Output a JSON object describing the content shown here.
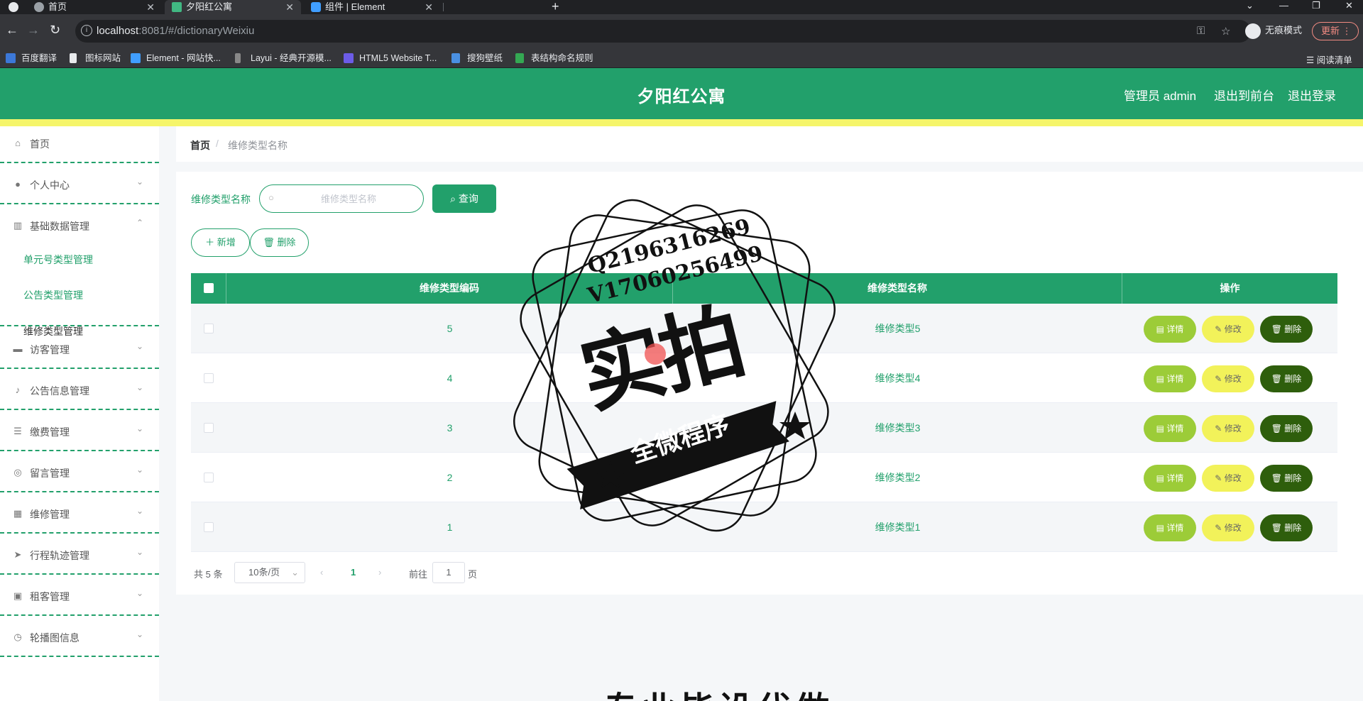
{
  "browser": {
    "tabs": [
      {
        "label": "首页",
        "active": false
      },
      {
        "label": "夕阳红公寓",
        "active": true
      },
      {
        "label": "组件 | Element",
        "active": false
      }
    ],
    "url_host": "localhost",
    "url_rest": ":8081/#/dictionaryWeixiu",
    "incognito_label": "无痕模式",
    "update_label": "更新",
    "bookmarks": [
      "百度翻译",
      "图标网站",
      "Element - 网站快...",
      "Layui - 经典开源模...",
      "HTML5 Website T...",
      "搜狗壁纸",
      "表结构命名规则"
    ],
    "reading_list": "阅读清单"
  },
  "header": {
    "title": "夕阳红公寓",
    "admin_label": "管理员 admin",
    "front_label": "退出到前台",
    "logout_label": "退出登录",
    "colors": {
      "primary": "#22a06b",
      "strip": "#f5f56a"
    }
  },
  "sidebar": {
    "items": [
      {
        "label": "首页",
        "icon": "home-icon"
      },
      {
        "label": "个人中心",
        "icon": "user-icon"
      },
      {
        "label": "基础数据管理",
        "icon": "library-icon"
      },
      {
        "label": "访客管理",
        "icon": "monitor-icon"
      },
      {
        "label": "公告信息管理",
        "icon": "microphone-icon"
      },
      {
        "label": "缴费管理",
        "icon": "sliders-icon"
      },
      {
        "label": "留言管理",
        "icon": "compass-icon"
      },
      {
        "label": "维修管理",
        "icon": "grid-icon"
      },
      {
        "label": "行程轨迹管理",
        "icon": "send-icon"
      },
      {
        "label": "租客管理",
        "icon": "clipboard-icon"
      },
      {
        "label": "轮播图信息",
        "icon": "clock-icon"
      }
    ],
    "submenu": [
      {
        "label": "单元号类型管理"
      },
      {
        "label": "公告类型管理"
      },
      {
        "label": "维修类型管理"
      }
    ]
  },
  "breadcrumb": {
    "home": "首页",
    "current": "维修类型名称"
  },
  "search": {
    "label": "维修类型名称",
    "placeholder": "维修类型名称",
    "value": "",
    "button": "查询"
  },
  "toolbar": {
    "add": "新增",
    "delete": "删除"
  },
  "table": {
    "headers": [
      "维修类型编码",
      "维修类型名称",
      "操作"
    ],
    "rows": [
      {
        "code": "5",
        "name": "维修类型5"
      },
      {
        "code": "4",
        "name": "维修类型4"
      },
      {
        "code": "3",
        "name": "维修类型3"
      },
      {
        "code": "2",
        "name": "维修类型2"
      },
      {
        "code": "1",
        "name": "维修类型1"
      }
    ],
    "actions": {
      "detail": "详情",
      "edit": "修改",
      "delete": "删除"
    }
  },
  "pagination": {
    "total": "共 5 条",
    "page_size": "10条/页",
    "current_page": "1",
    "goto_label": "前往",
    "goto_value": "1",
    "page_suffix": "页"
  },
  "watermark": {
    "line1": "Q2196316269",
    "line2": "V17060256499",
    "big": "实拍",
    "banner": "全微程序"
  },
  "bottom_text": "专业毕设代做"
}
